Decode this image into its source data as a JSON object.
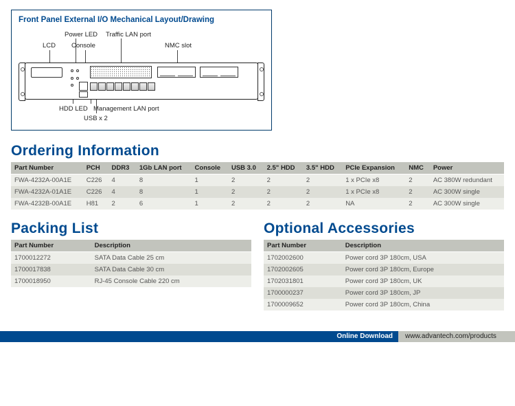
{
  "panel": {
    "title": "Front Panel External I/O Mechanical Layout/Drawing",
    "labels": {
      "lcd": "LCD",
      "power_led": "Power LED",
      "console": "Console",
      "traffic_lan": "Traffic LAN port",
      "nmc_slot": "NMC slot",
      "hdd_led": "HDD LED",
      "mgmt_lan": "Management LAN port",
      "usb": "USB x 2"
    }
  },
  "ordering": {
    "title": "Ordering Information",
    "headers": [
      "Part Number",
      "PCH",
      "DDR3",
      "1Gb LAN port",
      "Console",
      "USB 3.0",
      "2.5\" HDD",
      "3.5\" HDD",
      "PCIe Expansion",
      "NMC",
      "Power"
    ],
    "rows": [
      [
        "FWA-4232A-00A1E",
        "C226",
        "4",
        "8",
        "1",
        "2",
        "2",
        "2",
        "1 x PCIe x8",
        "2",
        "AC 380W redundant"
      ],
      [
        "FWA-4232A-01A1E",
        "C226",
        "4",
        "8",
        "1",
        "2",
        "2",
        "2",
        "1 x PCIe x8",
        "2",
        "AC 300W single"
      ],
      [
        "FWA-4232B-00A1E",
        "H81",
        "2",
        "6",
        "1",
        "2",
        "2",
        "2",
        "NA",
        "2",
        "AC 300W single"
      ]
    ]
  },
  "packing": {
    "title": "Packing List",
    "headers": [
      "Part Number",
      "Description"
    ],
    "rows": [
      [
        "1700012272",
        "SATA Data Cable 25 cm"
      ],
      [
        "1700017838",
        "SATA Data Cable 30 cm"
      ],
      [
        "1700018950",
        "RJ-45 Console Cable 220 cm"
      ]
    ]
  },
  "accessories": {
    "title": "Optional Accessories",
    "headers": [
      "Part Number",
      "Description"
    ],
    "rows": [
      [
        "1702002600",
        "Power cord 3P 180cm, USA"
      ],
      [
        "1702002605",
        "Power cord 3P 180cm, Europe"
      ],
      [
        "1702031801",
        "Power cord 3P 180cm, UK"
      ],
      [
        "1700000237",
        "Power cord 3P 180cm, JP"
      ],
      [
        "1700009652",
        "Power cord 3P 180cm, China"
      ]
    ]
  },
  "footer": {
    "label": "Online Download",
    "url": "www.advantech.com/products"
  }
}
